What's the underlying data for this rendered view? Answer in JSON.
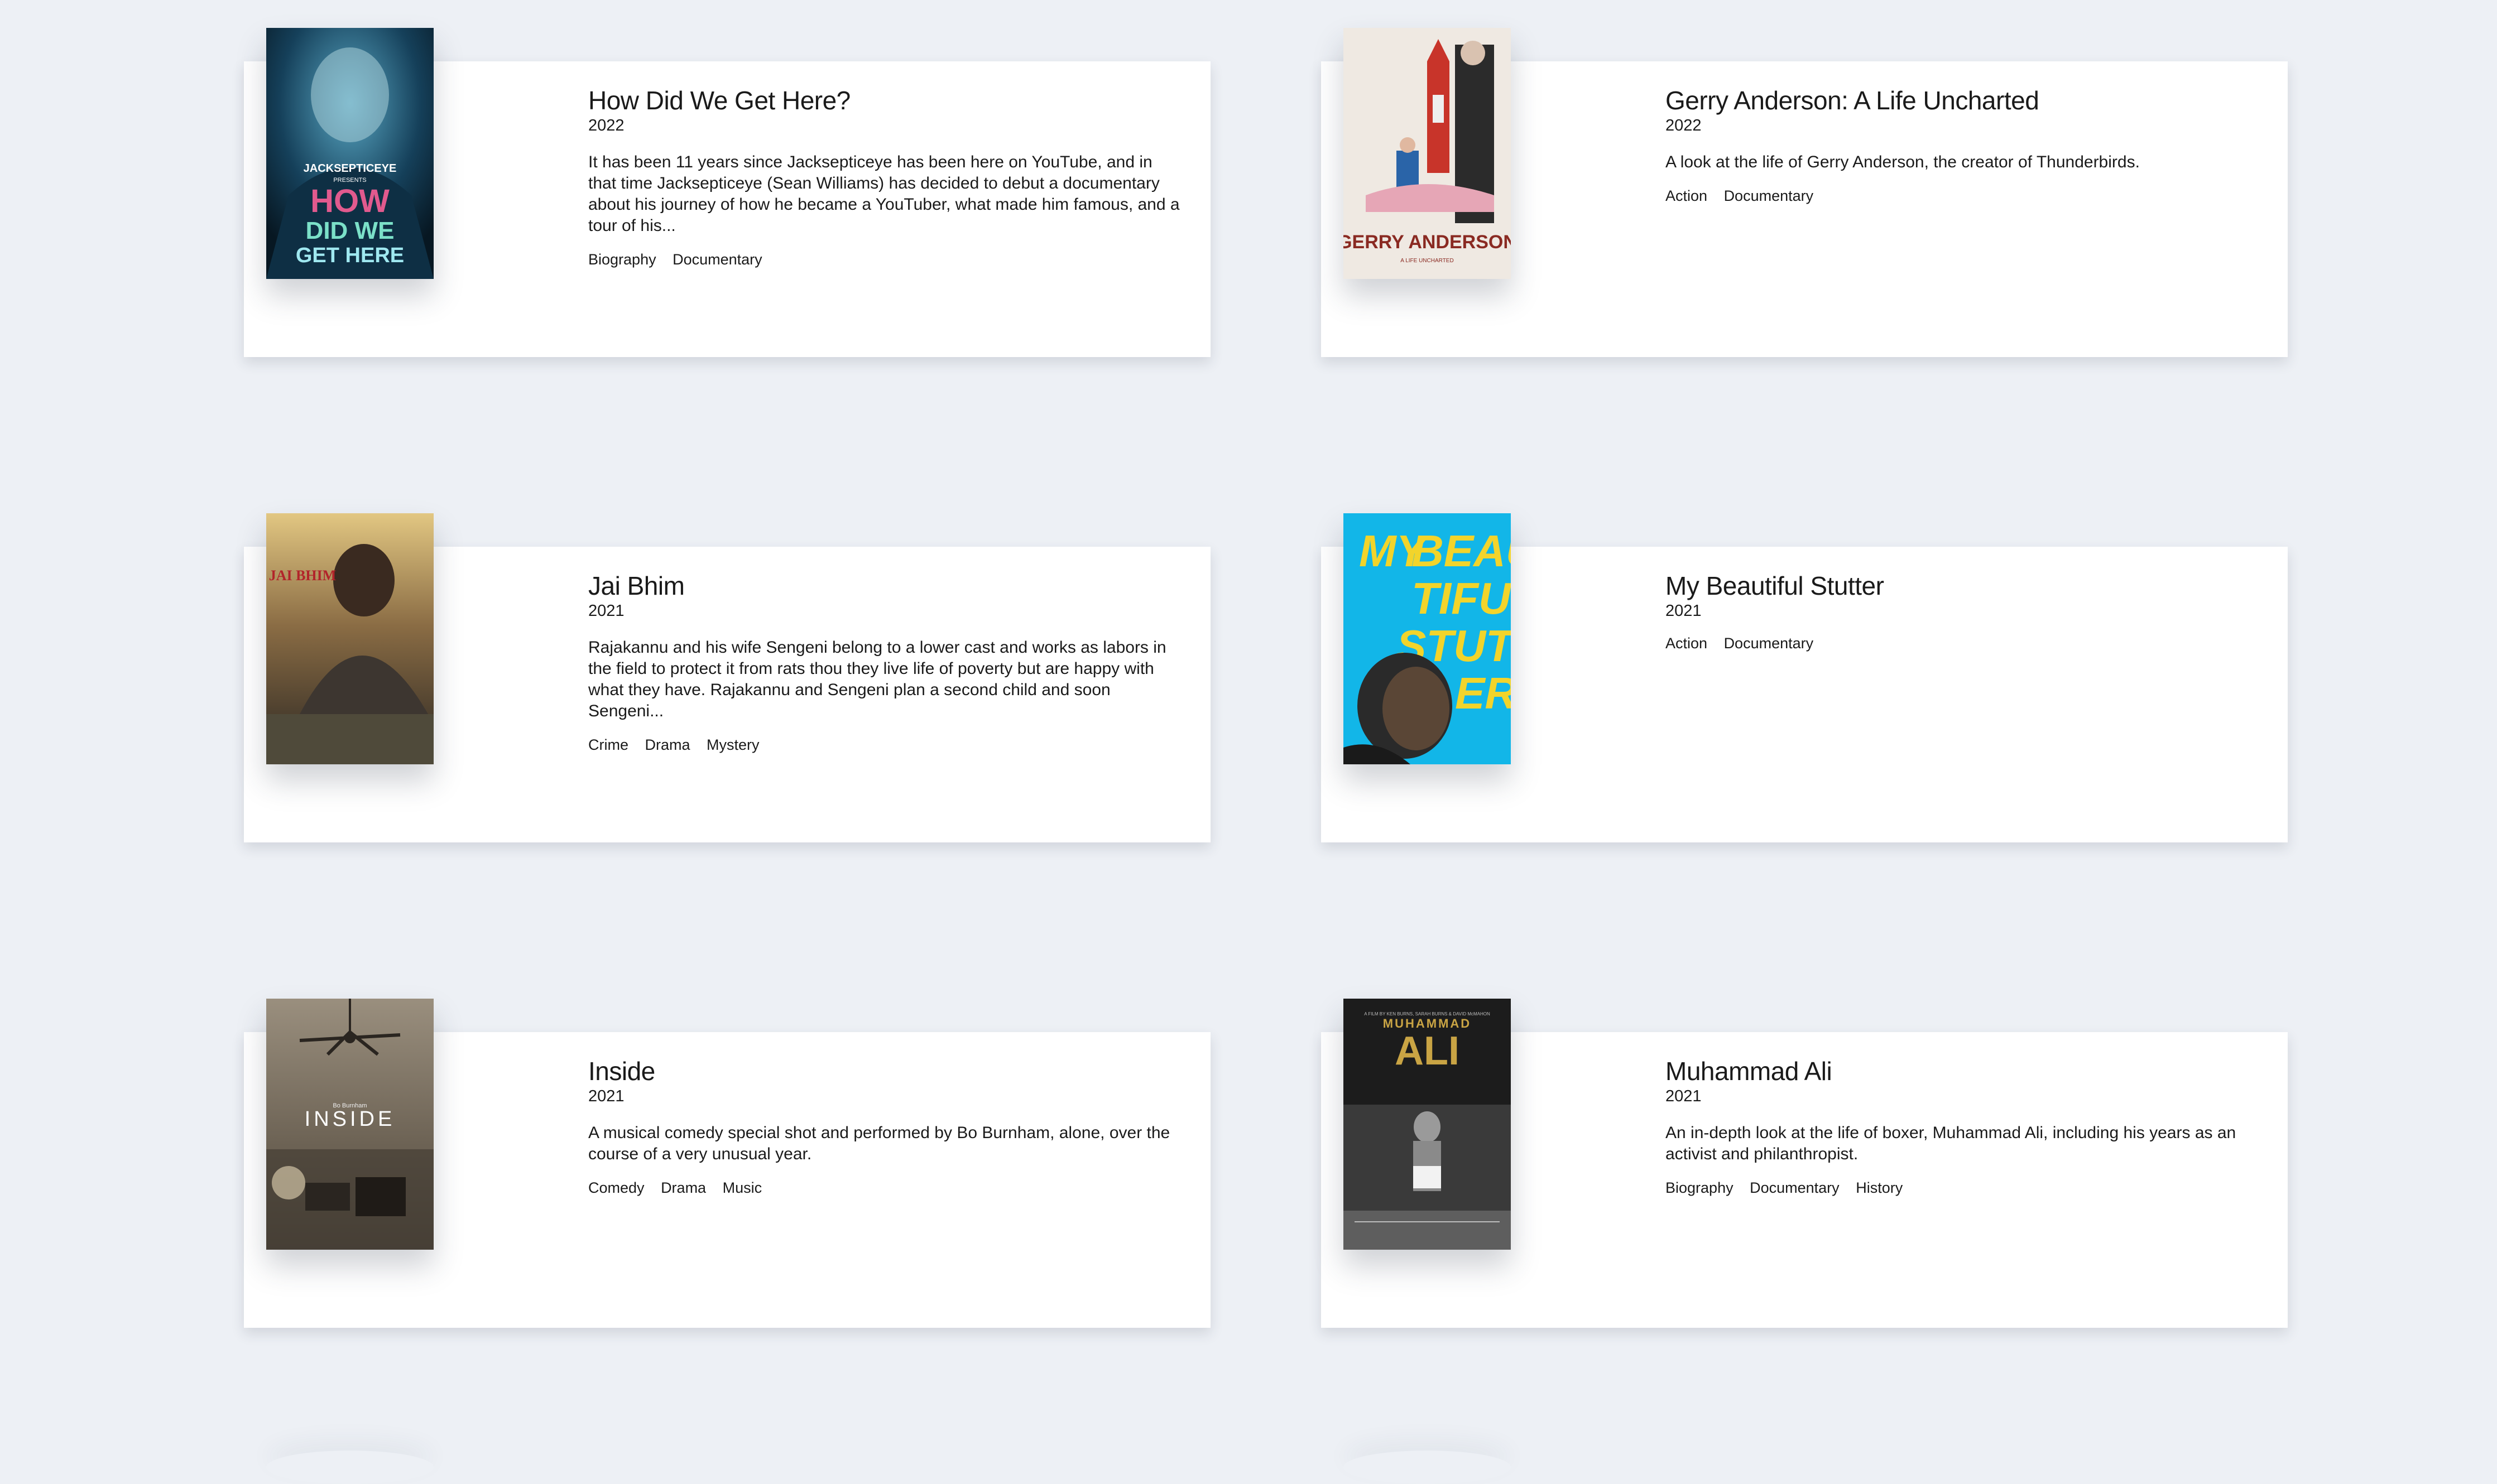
{
  "movies": [
    {
      "title": "How Did We Get Here?",
      "year": "2022",
      "description": "It has been 11 years since Jacksepticeye has been here on YouTube, and in that time Jacksepticeye (Sean Williams) has decided to debut a documentary about his journey of how he became a YouTuber, what made him famous, and a tour of his...",
      "genres": [
        "Biography",
        "Documentary"
      ],
      "poster_text": [
        "JACKSEPTICEYE",
        "PRESENTS",
        "HOW",
        "DID WE",
        "GET HERE"
      ],
      "poster_colors": [
        "#0b2233",
        "#1f6b86",
        "#7fd3e6"
      ]
    },
    {
      "title": "Gerry Anderson: A Life Uncharted",
      "year": "2022",
      "description": "A look at the life of Gerry Anderson, the creator of Thunderbirds.",
      "genres": [
        "Action",
        "Documentary"
      ],
      "poster_text": [
        "GERRY ANDERSON",
        "A LIFE UNCHARTED"
      ],
      "poster_colors": [
        "#efe9e2",
        "#c8342a",
        "#8a2a22"
      ]
    },
    {
      "title": "Jai Bhim",
      "year": "2021",
      "description": "Rajakannu and his wife Sengeni belong to a lower cast and works as labors in the field to protect it from rats thou they live life of poverty but are happy with what they have. Rajakannu and Sengeni plan a second child and soon Sengeni...",
      "genres": [
        "Crime",
        "Drama",
        "Mystery"
      ],
      "poster_text": [
        "JAI BHIM"
      ],
      "poster_colors": [
        "#c9a35a",
        "#4b3a2a",
        "#2a2622"
      ]
    },
    {
      "title": "My Beautiful Stutter",
      "year": "2021",
      "description": "",
      "genres": [
        "Action",
        "Documentary"
      ],
      "poster_text": [
        "MY",
        "BEAU",
        "TIFUL",
        "STUTT",
        "ER"
      ],
      "poster_colors": [
        "#12b6e8",
        "#f2d42b",
        "#1a1a1a"
      ]
    },
    {
      "title": "Inside",
      "year": "2021",
      "description": "A musical comedy special shot and performed by Bo Burnham, alone, over the course of a very unusual year.",
      "genres": [
        "Comedy",
        "Drama",
        "Music"
      ],
      "poster_text": [
        "Bo Burnham",
        "INSIDE"
      ],
      "poster_colors": [
        "#8a7e6e",
        "#5b5246",
        "#3a342d"
      ]
    },
    {
      "title": "Muhammad Ali",
      "year": "2021",
      "description": "An in-depth look at the life of boxer, Muhammad Ali, including his years as an activist and philanthropist.",
      "genres": [
        "Biography",
        "Documentary",
        "History"
      ],
      "poster_text": [
        "A FILM BY KEN BURNS, SARAH BURNS & DAVID McMAHON",
        "MUHAMMAD",
        "ALI"
      ],
      "poster_colors": [
        "#1c1c1c",
        "#c9a444",
        "#9a9a9a"
      ]
    }
  ]
}
